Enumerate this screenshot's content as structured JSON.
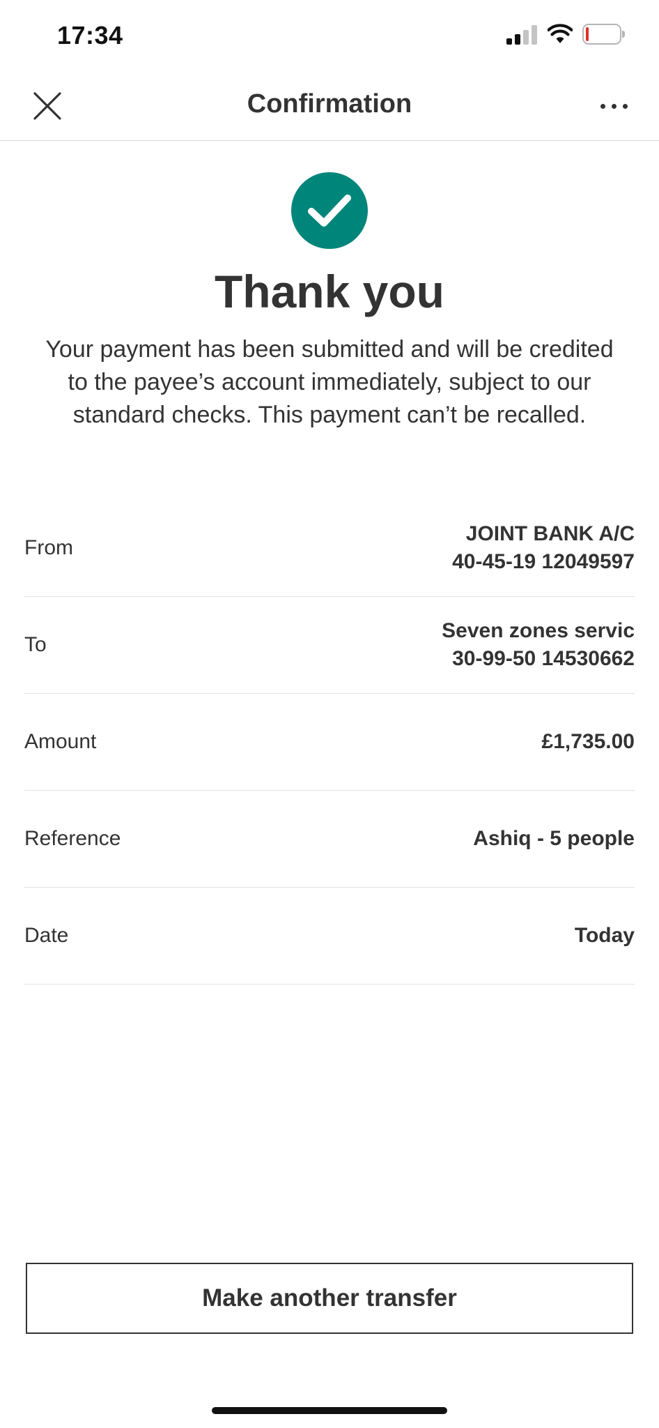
{
  "status_bar": {
    "time": "17:34",
    "icons": [
      "cellular-signal-icon",
      "wifi-icon",
      "battery-low-icon"
    ],
    "battery_level_color": "#e0302a"
  },
  "header": {
    "title": "Confirmation",
    "close_icon": "close-icon",
    "more_icon": "more-horizontal-icon"
  },
  "success": {
    "icon": "checkmark-circle-icon",
    "icon_color": "#00857a",
    "heading": "Thank you",
    "message": "Your payment has been submitted and will be credited to the payee’s account immediately, subject to our standard checks. This payment can’t be recalled."
  },
  "details": {
    "from": {
      "label": "From",
      "line1": "JOINT BANK A/C",
      "line2": "40-45-19 12049597"
    },
    "to": {
      "label": "To",
      "line1": "Seven zones servic",
      "line2": "30-99-50 14530662"
    },
    "amount": {
      "label": "Amount",
      "value": "£1,735.00"
    },
    "reference": {
      "label": "Reference",
      "value": "Ashiq - 5 people"
    },
    "date": {
      "label": "Date",
      "value": "Today"
    }
  },
  "actions": {
    "primary_label": "Make another transfer"
  }
}
